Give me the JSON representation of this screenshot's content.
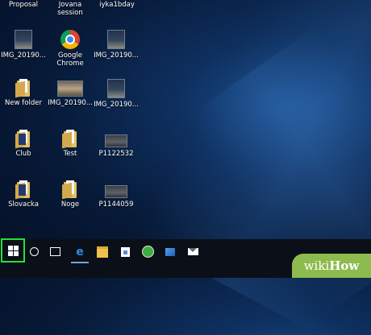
{
  "desktop": {
    "top_labels": [
      "Proposal",
      "Jovana session",
      "iyka1bday"
    ],
    "icons": [
      {
        "label": "IMG_20190...",
        "icon": "photo-thumbnail-icon"
      },
      {
        "label": "Google Chrome",
        "icon": "chrome-icon"
      },
      {
        "label": "IMG_20190...",
        "icon": "photo-thumbnail-icon"
      },
      {
        "label": "New folder",
        "icon": "folder-icon"
      },
      {
        "label": "IMG_20190...",
        "icon": "photo-thumbnail-icon"
      },
      {
        "label": "IMG_20190...",
        "icon": "photo-thumbnail-icon"
      },
      {
        "label": "Club",
        "icon": "folder-icon"
      },
      {
        "label": "Test",
        "icon": "folder-icon"
      },
      {
        "label": "P1122532",
        "icon": "photo-thumbnail-icon"
      },
      {
        "label": "Slovacka",
        "icon": "folder-icon"
      },
      {
        "label": "Noge",
        "icon": "folder-icon"
      },
      {
        "label": "P1144059",
        "icon": "photo-thumbnail-icon"
      }
    ]
  },
  "taskbar": {
    "items": [
      "start-button",
      "search-button",
      "task-view-button",
      "edge-button",
      "file-explorer-button",
      "store-button",
      "clock-app-button",
      "photos-button",
      "mail-button"
    ],
    "highlight_color": "#22e03c"
  },
  "watermark": {
    "wiki": "wiki",
    "how": "How"
  }
}
